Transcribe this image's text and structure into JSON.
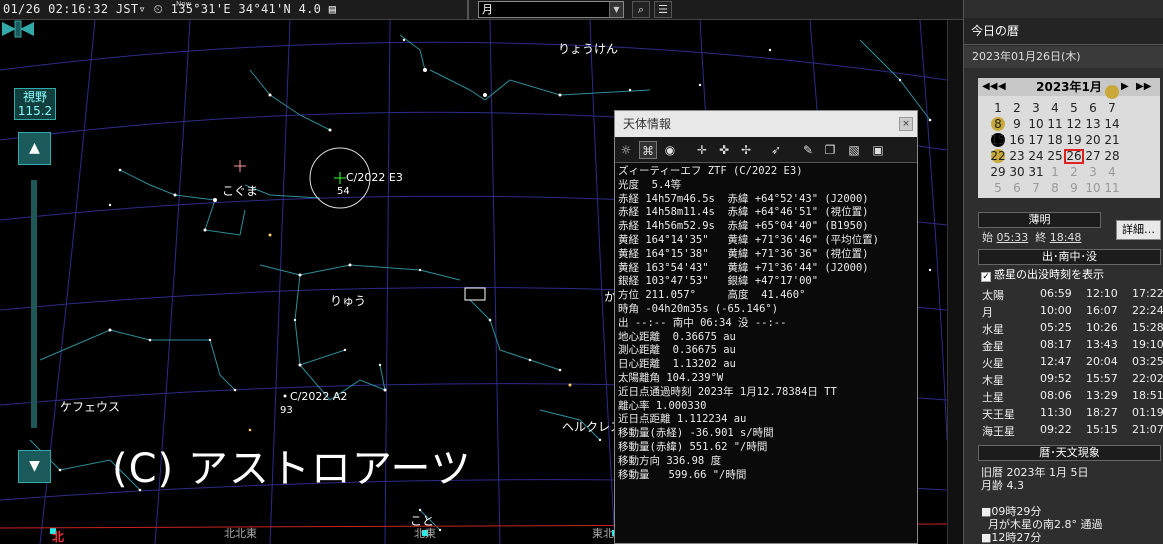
{
  "topbar": {
    "status": "01/26 02:16:32 JST▿ ⏲ 135°31'E 34°41'N  4.0 ▤",
    "now_label": "Now",
    "object_select": "月"
  },
  "sky": {
    "constellations": [
      "りょうけん",
      "こぐま",
      "りゅう",
      "ケフェウス",
      "ヘルクレス",
      "か",
      "こと"
    ],
    "objects": [
      {
        "name": "C/2022 E3",
        "mag": "54"
      },
      {
        "name": "C/2022 A2",
        "mag": "93"
      }
    ],
    "directions": [
      "北",
      "北北東",
      "北東",
      "東北"
    ],
    "copyright": "(C) アストロアーツ"
  },
  "fov": {
    "label": "視野",
    "value": "115.2"
  },
  "info_panel": {
    "title": "天体情報",
    "close": "×",
    "lines": [
      "ズィーティーエフ ZTF (C/2022 E3)",
      "光度  5.4等",
      "赤経 14h57m46.5s  赤緯 +64°52'43\" (J2000)",
      "赤経 14h58m11.4s  赤緯 +64°46'51\" (視位置)",
      "赤経 14h56m52.9s  赤緯 +65°04'40\" (B1950)",
      "黄経 164°14'35\"   黄緯 +71°36'46\" (平均位置)",
      "黄経 164°15'38\"   黄緯 +71°36'36\" (視位置)",
      "黄経 163°54'43\"   黄緯 +71°36'44\" (J2000)",
      "銀経 103°47'53\"   銀緯 +47°17'00\"",
      "方位 211.057°     高度  41.460°",
      "時角 -04h20m35s (-65.146°)",
      "出 --:-- 南中 06:34 没 --:--",
      "地心距離  0.36675 au",
      "測心距離  0.36675 au",
      "日心距離  1.13202 au",
      "太陽離角 104.239°W",
      "近日点通過時刻 2023年 1月12.78384日 TT",
      "離心率 1.000330",
      "近日点距離 1.112234 au",
      "移動量(赤経) -36.901 s/時間",
      "移動量(赤緯) 551.62 \"/時間",
      "移動方向 336.98 度",
      "移動量   599.66 \"/時間"
    ]
  },
  "sidebar": {
    "header": "今日の暦",
    "date": "2023年01月26日(木)",
    "calendar": {
      "title": "2023年1月",
      "prev_year": "◀◀",
      "prev_month": "◀",
      "next_month": "▶",
      "next_year": "▶▶",
      "weeks": [
        [
          "1",
          "2",
          "3",
          "4",
          "5",
          "6",
          "7"
        ],
        [
          "8",
          "9",
          "10",
          "11",
          "12",
          "13",
          "14"
        ],
        [
          "15",
          "16",
          "17",
          "18",
          "19",
          "20",
          "21"
        ],
        [
          "22",
          "23",
          "24",
          "25",
          "26",
          "27",
          "28"
        ],
        [
          "29",
          "30",
          "31",
          "1",
          "2",
          "3",
          "4"
        ],
        [
          "5",
          "6",
          "7",
          "8",
          "9",
          "10",
          "11"
        ]
      ],
      "today": "26"
    },
    "twilight_title": "薄明",
    "twilight_start_label": "始",
    "twilight_start": "05:33",
    "twilight_end_label": "終",
    "twilight_end": "18:48",
    "detail_button": "詳細…",
    "rst_title": "出･南中･没",
    "planet_checkbox": "惑星の出没時刻を表示",
    "bodies": [
      {
        "name": "太陽",
        "rise": "06:59",
        "transit": "12:10",
        "set": "17:22"
      },
      {
        "name": "月",
        "rise": "10:00",
        "transit": "16:07",
        "set": "22:24"
      },
      {
        "name": "水星",
        "rise": "05:25",
        "transit": "10:26",
        "set": "15:28"
      },
      {
        "name": "金星",
        "rise": "08:17",
        "transit": "13:43",
        "set": "19:10"
      },
      {
        "name": "火星",
        "rise": "12:47",
        "transit": "20:04",
        "set": "03:25"
      },
      {
        "name": "木星",
        "rise": "09:52",
        "transit": "15:57",
        "set": "22:02"
      },
      {
        "name": "土星",
        "rise": "08:06",
        "transit": "13:29",
        "set": "18:51"
      },
      {
        "name": "天王星",
        "rise": "11:30",
        "transit": "18:27",
        "set": "01:19"
      },
      {
        "name": "海王星",
        "rise": "09:22",
        "transit": "15:15",
        "set": "21:07"
      }
    ],
    "phenomena_title": "暦･天文現象",
    "phenomena": "旧暦 2023年 1月 5日\n月齢 4.3\n\n■09時29分\n  月が木星の南2.8° 通過\n■12時27分"
  }
}
